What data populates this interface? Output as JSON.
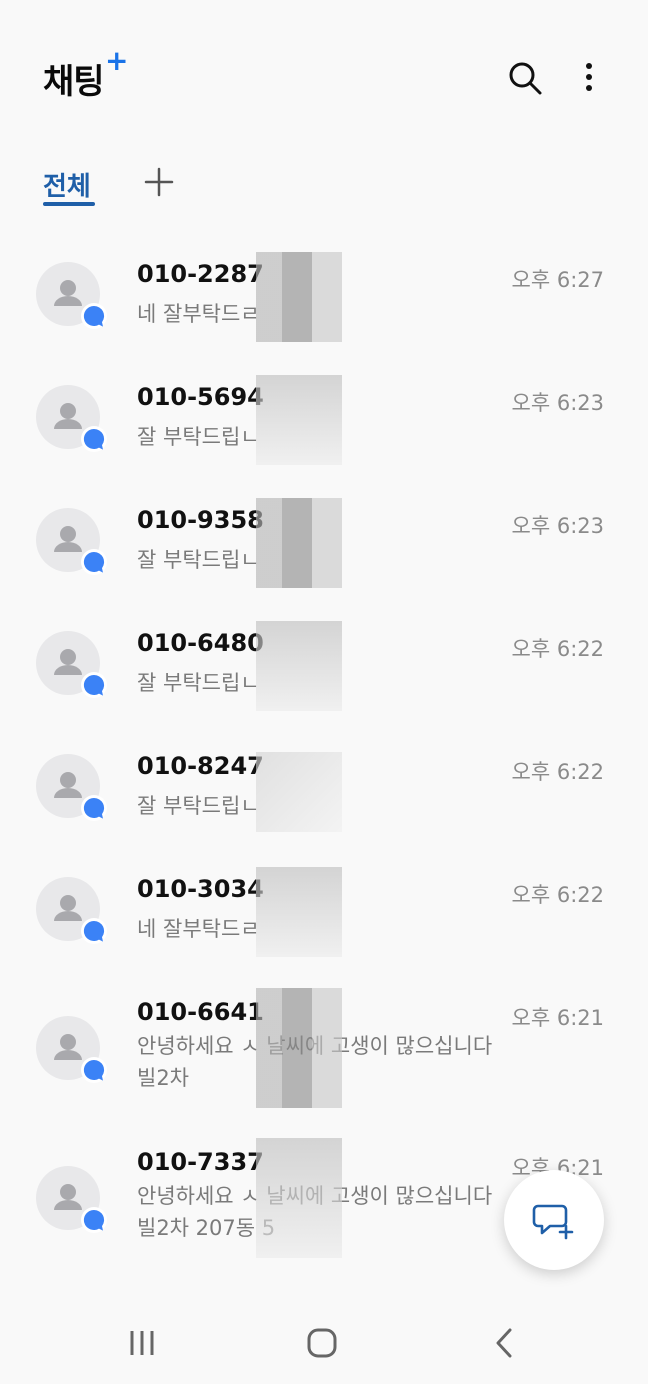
{
  "header": {
    "title": "채팅",
    "title_plus": "+",
    "search_icon": "search-icon",
    "more_icon": "more-vertical-icon"
  },
  "tabs": {
    "all_label": "전체",
    "add_icon": "plus-icon"
  },
  "colors": {
    "accent": "#1f5fa8",
    "badge": "#3b82f6",
    "title_plus": "#1a73e8"
  },
  "conversations": [
    {
      "name": "010-2287",
      "preview": "네 잘부탁드ㄹ",
      "time": "오후 6:27"
    },
    {
      "name": "010-5694",
      "preview": "잘 부탁드립ㄴ",
      "time": "오후 6:23"
    },
    {
      "name": "010-9358",
      "preview": "잘 부탁드립ㄴ",
      "time": "오후 6:23"
    },
    {
      "name": "010-6480",
      "preview": "잘 부탁드립ㄴ",
      "time": "오후 6:22"
    },
    {
      "name": "010-8247",
      "preview": "잘 부탁드립ㄴ",
      "time": "오후 6:22"
    },
    {
      "name": "010-3034",
      "preview": "네 잘부탁드ㄹ",
      "time": "오후 6:22"
    },
    {
      "name": "010-6641",
      "preview": "안녕하세요 ㅅ 날씨에 고생이 많으십니다 빌2차",
      "time": "오후 6:21"
    },
    {
      "name": "010-7337",
      "preview": "안녕하세요 ㅅ 날씨에 고생이 많으십니다 빌2차 207동 5",
      "time": "오후 6:21"
    }
  ],
  "fab": {
    "icon": "new-chat-icon"
  },
  "navbar": {
    "recents_icon": "recents-icon",
    "home_icon": "home-icon",
    "back_icon": "back-icon"
  }
}
